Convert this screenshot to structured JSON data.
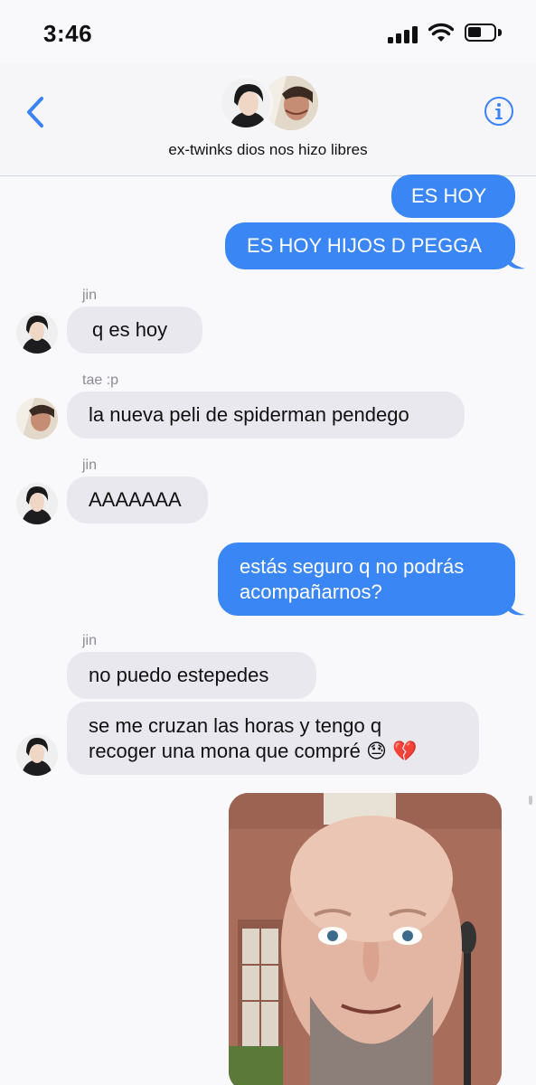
{
  "status": {
    "time": "3:46",
    "icons": [
      "signal-icon",
      "wifi-icon",
      "battery-icon"
    ]
  },
  "header": {
    "group_name": "ex-twinks dios nos hizo libres",
    "back_icon": "chevron-left-icon",
    "info_icon": "info-icon",
    "accent": "#3b82f6"
  },
  "messages": [
    {
      "type": "out",
      "text": "ES HOY"
    },
    {
      "type": "out",
      "text": "ES HOY HIJOS D PEGGA"
    },
    {
      "type": "in",
      "sender": "jin",
      "text": "q es hoy"
    },
    {
      "type": "in",
      "sender": "tae :p",
      "text": "la nueva peli de spiderman pendego"
    },
    {
      "type": "in",
      "sender": "jin",
      "text": "AAAAAAA"
    },
    {
      "type": "out",
      "text_line1": "estás seguro q no podrás",
      "text_line2": "acompañarnos?"
    },
    {
      "type": "in",
      "sender": "jin",
      "text": "no puedo estepedes"
    },
    {
      "type": "in",
      "text_line1": "se me cruzan las horas y tengo q",
      "text_line2": "recoger una mona que compré 😓 💔"
    },
    {
      "type": "out-image",
      "description": "photo"
    }
  ],
  "colors": {
    "outgoing": "#3b86f5",
    "incoming": "#e9e8ee",
    "background": "#f9f9fb"
  }
}
